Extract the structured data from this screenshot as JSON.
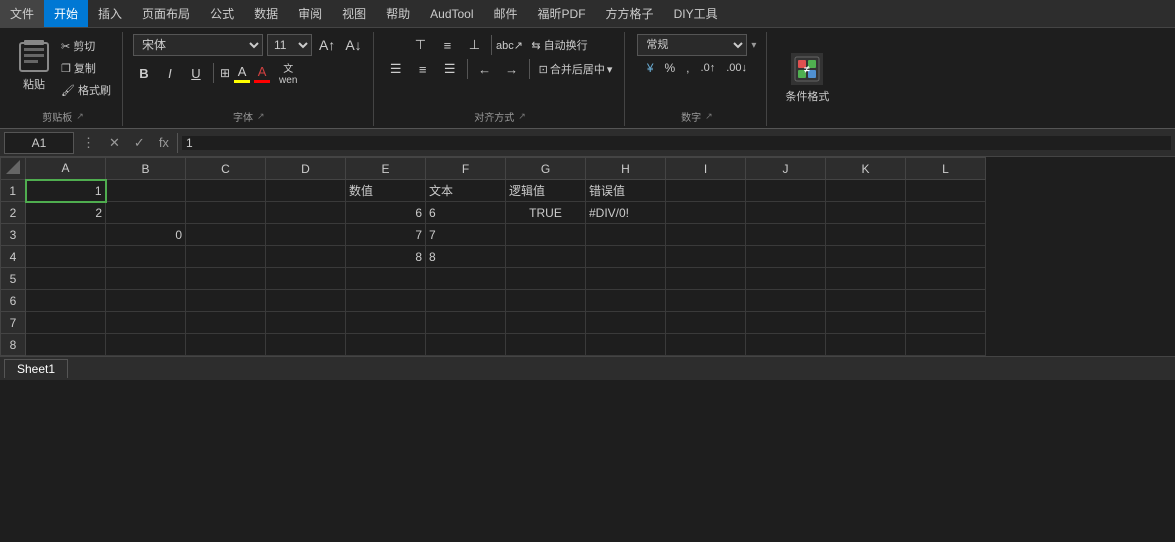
{
  "menubar": {
    "items": [
      "文件",
      "开始",
      "插入",
      "页面布局",
      "公式",
      "数据",
      "审阅",
      "视图",
      "帮助",
      "AudTool",
      "邮件",
      "福昕PDF",
      "方方格子",
      "DIY工具"
    ]
  },
  "ribbon": {
    "activeTab": "开始",
    "tabs": [
      "文件",
      "开始",
      "插入",
      "页面布局",
      "公式",
      "数据",
      "审阅",
      "视图",
      "帮助",
      "AudTool",
      "邮件",
      "福昕PDF",
      "方方格子",
      "DIY工具"
    ],
    "groups": {
      "clipboard": {
        "label": "剪贴板",
        "paste": "粘贴",
        "cut": "剪切",
        "copy": "复制",
        "format_painter": "格式刷"
      },
      "font": {
        "label": "字体",
        "font_name": "宋体",
        "font_size": "11",
        "bold": "B",
        "italic": "I",
        "underline": "U",
        "border": "⊞",
        "fill_color": "A",
        "font_color": "A",
        "fill_color_bar": "#ffff00",
        "font_color_bar": "#ff0000"
      },
      "alignment": {
        "label": "对齐方式",
        "wrap_text": "自动换行",
        "merge_label": "合并后居中",
        "top_align": "⊤",
        "mid_align": "≡",
        "bot_align": "⊥",
        "left_align": "≡",
        "center_align": "≡",
        "right_align": "≡",
        "indent_dec": "←",
        "indent_inc": "→"
      },
      "number": {
        "label": "数字",
        "format": "常规",
        "percent": "%",
        "comma": ",",
        "currency": "¥",
        "inc_decimal": ".0",
        "dec_decimal": ".00"
      },
      "conditional": {
        "label": "条件格式",
        "label2": "条件格式"
      }
    }
  },
  "formula_bar": {
    "cell_ref": "A1",
    "formula": "1"
  },
  "sheet": {
    "columns": [
      "",
      "A",
      "B",
      "C",
      "D",
      "E",
      "F",
      "G",
      "H",
      "I",
      "J",
      "K",
      "L"
    ],
    "rows": [
      {
        "row": "1",
        "cells": {
          "A": {
            "value": "1",
            "type": "number",
            "selected": true
          },
          "B": {
            "value": "",
            "type": "text"
          },
          "C": {
            "value": "",
            "type": "text"
          },
          "D": {
            "value": "",
            "type": "text"
          },
          "E": {
            "value": "数值",
            "type": "text"
          },
          "F": {
            "value": "文本",
            "type": "text"
          },
          "G": {
            "value": "逻辑值",
            "type": "text"
          },
          "H": {
            "value": "错误值",
            "type": "text"
          },
          "I": {
            "value": "",
            "type": "text"
          },
          "J": {
            "value": "",
            "type": "text"
          },
          "K": {
            "value": "",
            "type": "text"
          },
          "L": {
            "value": "",
            "type": "text"
          }
        }
      },
      {
        "row": "2",
        "cells": {
          "A": {
            "value": "2",
            "type": "number"
          },
          "B": {
            "value": "",
            "type": "text"
          },
          "C": {
            "value": "",
            "type": "text"
          },
          "D": {
            "value": "",
            "type": "text"
          },
          "E": {
            "value": "6",
            "type": "number",
            "color": "green"
          },
          "F": {
            "value": "6",
            "type": "text",
            "color": "green"
          },
          "G": {
            "value": "TRUE",
            "type": "logical"
          },
          "H": {
            "value": "#DIV/0!",
            "type": "error"
          },
          "I": {
            "value": "",
            "type": "text"
          },
          "J": {
            "value": "",
            "type": "text"
          },
          "K": {
            "value": "",
            "type": "text"
          },
          "L": {
            "value": "",
            "type": "text"
          }
        }
      },
      {
        "row": "3",
        "cells": {
          "A": {
            "value": "",
            "type": "text"
          },
          "B": {
            "value": "0",
            "type": "number"
          },
          "C": {
            "value": "",
            "type": "text"
          },
          "D": {
            "value": "",
            "type": "text"
          },
          "E": {
            "value": "7",
            "type": "number",
            "color": "green"
          },
          "F": {
            "value": "7",
            "type": "text",
            "color": "green"
          },
          "G": {
            "value": "",
            "type": "text"
          },
          "H": {
            "value": "",
            "type": "text"
          },
          "I": {
            "value": "",
            "type": "text"
          },
          "J": {
            "value": "",
            "type": "text"
          },
          "K": {
            "value": "",
            "type": "text"
          },
          "L": {
            "value": "",
            "type": "text"
          }
        }
      },
      {
        "row": "4",
        "cells": {
          "A": {
            "value": "",
            "type": "text"
          },
          "B": {
            "value": "",
            "type": "text"
          },
          "C": {
            "value": "",
            "type": "text"
          },
          "D": {
            "value": "",
            "type": "text"
          },
          "E": {
            "value": "8",
            "type": "number",
            "color": "green"
          },
          "F": {
            "value": "8",
            "type": "text",
            "color": "green"
          },
          "G": {
            "value": "",
            "type": "text"
          },
          "H": {
            "value": "",
            "type": "text"
          },
          "I": {
            "value": "",
            "type": "text"
          },
          "J": {
            "value": "",
            "type": "text"
          },
          "K": {
            "value": "",
            "type": "text"
          },
          "L": {
            "value": "",
            "type": "text"
          }
        }
      },
      {
        "row": "5",
        "cells": {}
      },
      {
        "row": "6",
        "cells": {}
      },
      {
        "row": "7",
        "cells": {}
      },
      {
        "row": "8",
        "cells": {}
      }
    ],
    "active_cell": "A1",
    "sheet_tabs": [
      "Sheet1"
    ]
  }
}
